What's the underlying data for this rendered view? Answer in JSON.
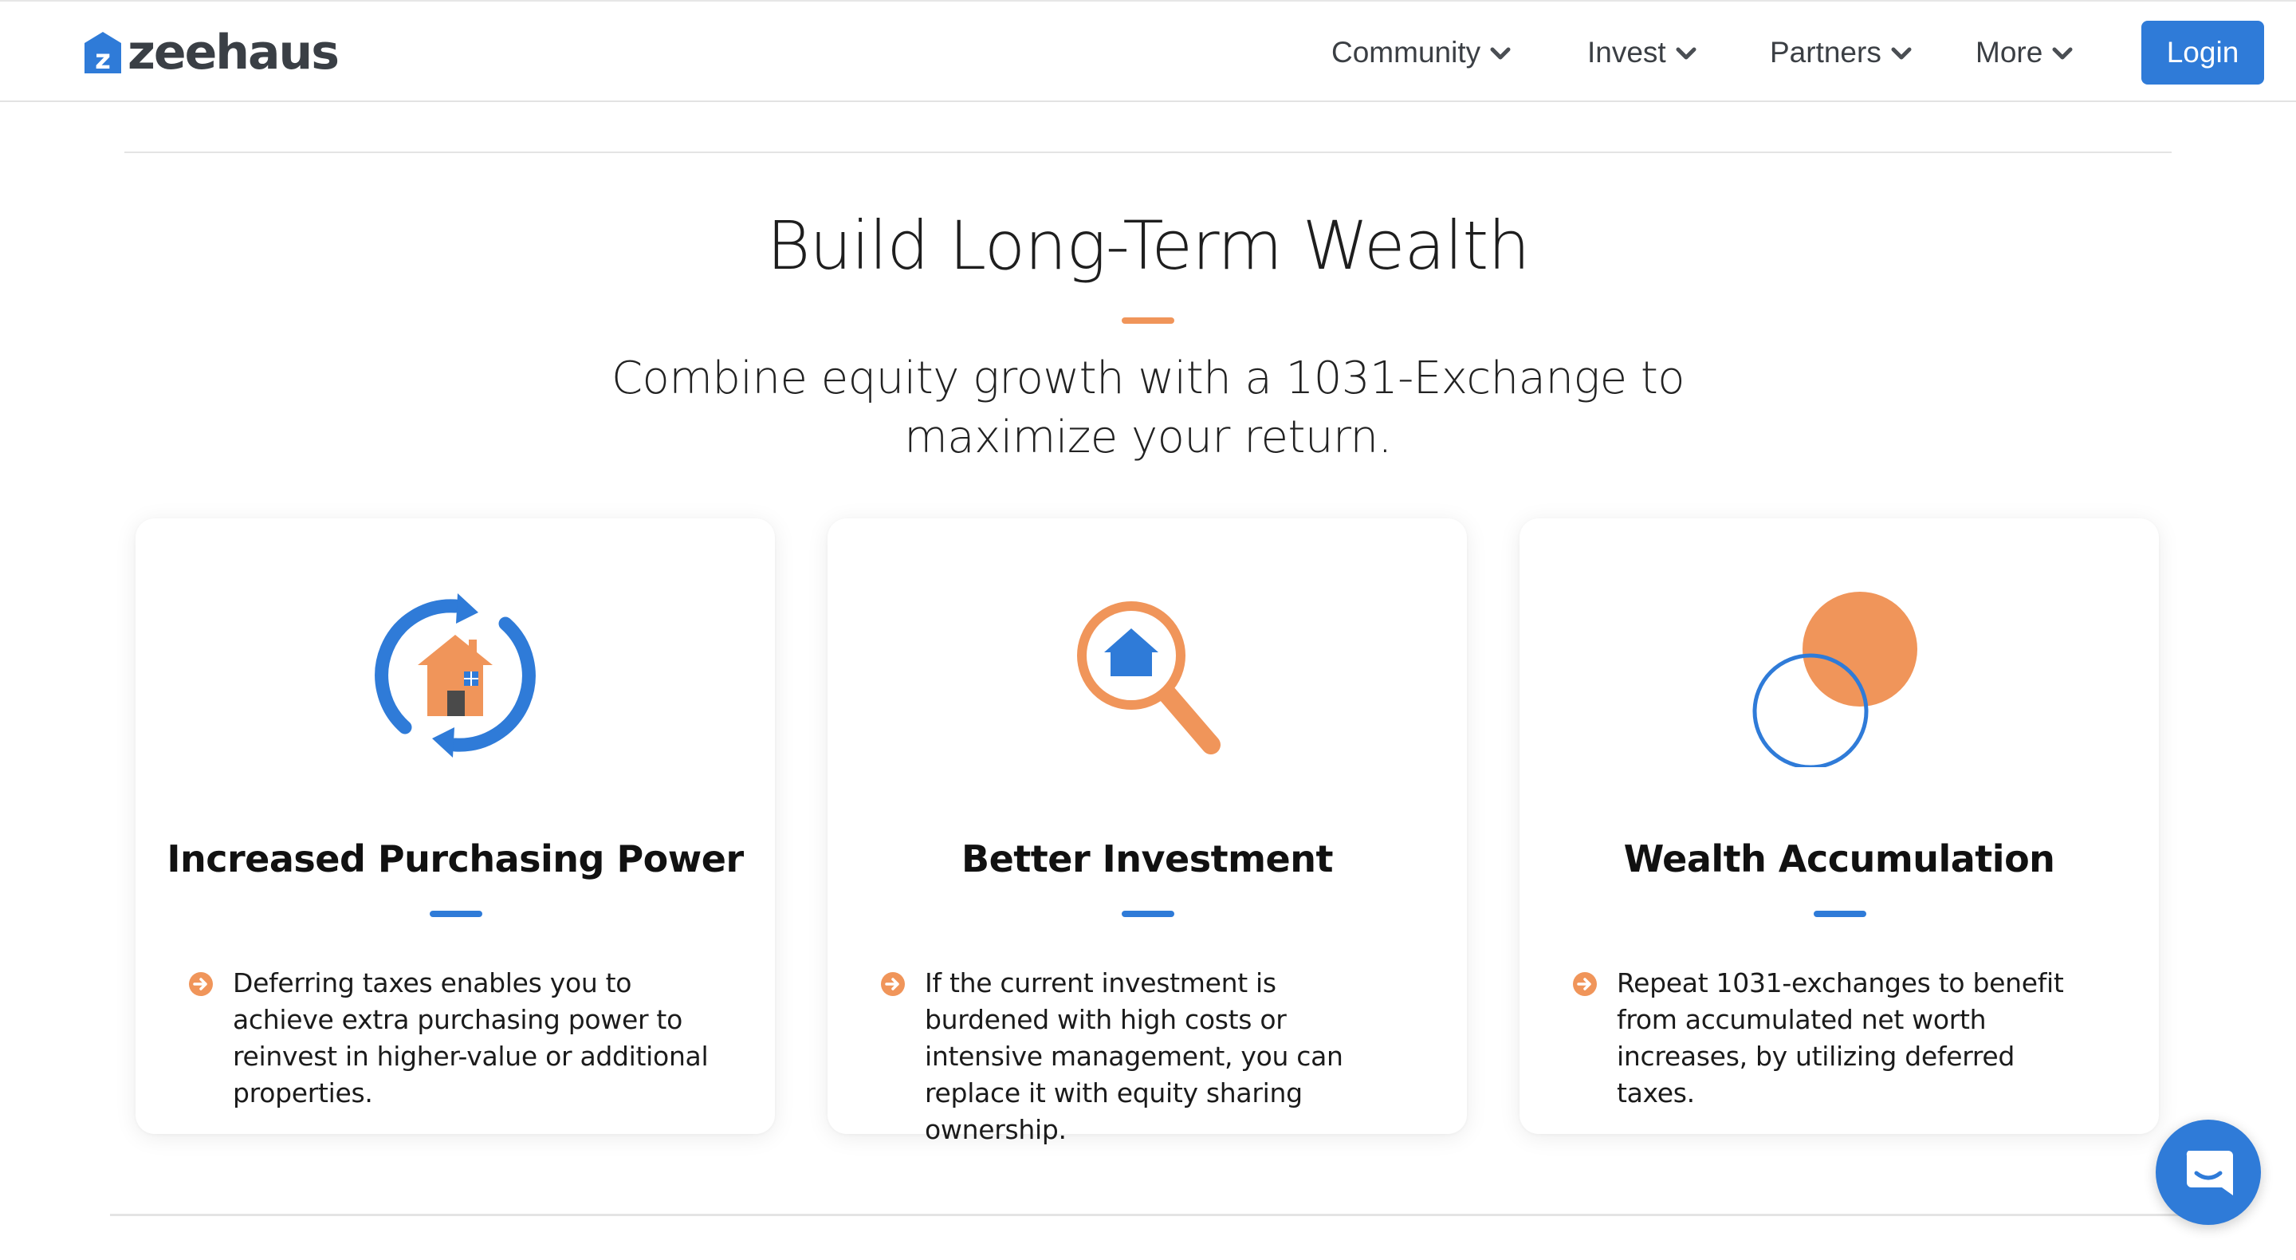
{
  "brand": {
    "name": "zeehaus",
    "mark_letter": "z"
  },
  "nav": {
    "items": [
      {
        "label": "Community"
      },
      {
        "label": "Invest"
      },
      {
        "label": "Partners"
      },
      {
        "label": "More"
      }
    ],
    "login_label": "Login"
  },
  "hero": {
    "title": "Build Long-Term Wealth",
    "subtitle": "Combine equity growth with a 1031-Exchange to maximize your return."
  },
  "cards": [
    {
      "icon": "house-cycle-icon",
      "title": "Increased Purchasing Power",
      "text": "Deferring taxes enables you to achieve extra purchasing power to reinvest in higher-value or additional properties."
    },
    {
      "icon": "magnifier-house-icon",
      "title": "Better Investment",
      "text": "If the current investment is burdened with high costs or intensive management, you can replace it with equity sharing ownership."
    },
    {
      "icon": "overlapping-circles-icon",
      "title": "Wealth Accumulation",
      "text": "Repeat 1031-exchanges to benefit from accumulated net worth increases, by utilizing deferred taxes."
    }
  ],
  "colors": {
    "primary_blue": "#2f7bd8",
    "accent_orange": "#f0955a",
    "nav_text": "#3b3f44"
  },
  "chat": {
    "icon": "chat-icon"
  }
}
